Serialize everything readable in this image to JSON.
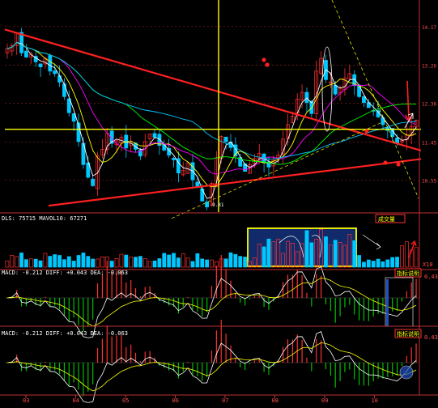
{
  "colors": {
    "background": "#000000",
    "up": "#ff3030",
    "down": "#00c8ff",
    "grid": "#8a2020",
    "ma5": "#ffffff",
    "ma10": "#ffff00",
    "ma20": "#ff00ff",
    "ma60": "#00ff00",
    "ma120": "#00c8ff",
    "trendline": "#ff2020",
    "highlight": "#ffff00",
    "axis_text": "#ff5050",
    "volume_box_fill": "#102a6a",
    "macd_pos": "#ff3030",
    "macd_neg": "#00c000"
  },
  "chart_data": [
    {
      "type": "line",
      "panel": "price",
      "y_ticks": [
        "14.17",
        "13.26",
        "12.36",
        "11.45",
        "10.55"
      ],
      "ylim": [
        9.8,
        14.7
      ],
      "low_label": "9.81",
      "months": [
        "03",
        "04",
        "05",
        "06",
        "07",
        "08",
        "09",
        "10"
      ],
      "grid": true,
      "series": [
        {
          "values": [
            13.65,
            13.72,
            14.02,
            13.55,
            13.45,
            13.52,
            13.34,
            13.22,
            13.42,
            13.12,
            13.06,
            12.86,
            12.52,
            12.14,
            11.94,
            11.46,
            10.92,
            10.62,
            10.42,
            11.12,
            11.28,
            11.66,
            11.42,
            11.48,
            11.56,
            11.31,
            11.42,
            11.28,
            11.12,
            11.46,
            11.64,
            11.56,
            11.37,
            11.26,
            11.14,
            11.03,
            10.72,
            10.78,
            10.96,
            10.56,
            10.38,
            10.06,
            9.92,
            10.48,
            11.08,
            11.58,
            11.46,
            11.32,
            11.12,
            10.88,
            10.76,
            10.92,
            11.06,
            11.18,
            10.96,
            10.86,
            11.02,
            11.14,
            11.52,
            11.86,
            12.06,
            12.46,
            12.62,
            12.38,
            12.12,
            13.12,
            13.42,
            12.92,
            12.86,
            12.58,
            12.72,
            12.96,
            13.06,
            12.78,
            12.52,
            12.38,
            12.26,
            12.18,
            12.04,
            11.86,
            11.72,
            11.58,
            11.42,
            11.48,
            11.62,
            11.82,
            11.96
          ]
        }
      ]
    },
    {
      "type": "bar",
      "panel": "volume",
      "header": "DLS: 75715 MAVOL10: 67271",
      "badge": "成交量",
      "axis_label": "X10"
    },
    {
      "type": "bar",
      "panel": "macd_1",
      "header": "MACD: -0.212 DIFF: +0.043 DEA: -0.063",
      "badge": "指标说明",
      "axis_label": "0.43"
    },
    {
      "type": "bar",
      "panel": "macd_2",
      "header": "MACD: -0.212 DIFF: +0.043 DEA: -0.063",
      "badge": "指标说明",
      "axis_label": "0.43"
    }
  ]
}
